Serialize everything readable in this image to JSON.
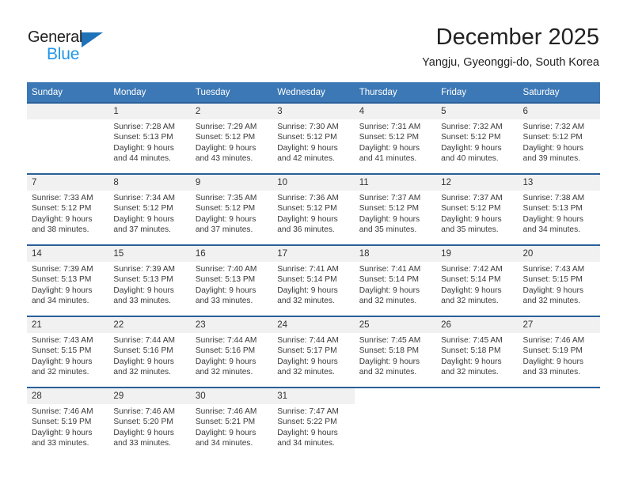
{
  "brand": {
    "name_part1": "General",
    "name_part2": "Blue",
    "triangle_color": "#1f72b8",
    "blue_color": "#2196e8"
  },
  "header": {
    "title": "December 2025",
    "subtitle": "Yangju, Gyeonggi-do, South Korea"
  },
  "theme": {
    "header_blue": "#3c78b5",
    "row_border_blue": "#2a6099",
    "daynum_strip": "#f1f1f1"
  },
  "weekdays": [
    "Sunday",
    "Monday",
    "Tuesday",
    "Wednesday",
    "Thursday",
    "Friday",
    "Saturday"
  ],
  "weeks": [
    [
      {
        "day": "",
        "sunrise": "",
        "sunset": "",
        "daylight1": "",
        "daylight2": ""
      },
      {
        "day": "1",
        "sunrise": "Sunrise: 7:28 AM",
        "sunset": "Sunset: 5:13 PM",
        "daylight1": "Daylight: 9 hours",
        "daylight2": "and 44 minutes."
      },
      {
        "day": "2",
        "sunrise": "Sunrise: 7:29 AM",
        "sunset": "Sunset: 5:12 PM",
        "daylight1": "Daylight: 9 hours",
        "daylight2": "and 43 minutes."
      },
      {
        "day": "3",
        "sunrise": "Sunrise: 7:30 AM",
        "sunset": "Sunset: 5:12 PM",
        "daylight1": "Daylight: 9 hours",
        "daylight2": "and 42 minutes."
      },
      {
        "day": "4",
        "sunrise": "Sunrise: 7:31 AM",
        "sunset": "Sunset: 5:12 PM",
        "daylight1": "Daylight: 9 hours",
        "daylight2": "and 41 minutes."
      },
      {
        "day": "5",
        "sunrise": "Sunrise: 7:32 AM",
        "sunset": "Sunset: 5:12 PM",
        "daylight1": "Daylight: 9 hours",
        "daylight2": "and 40 minutes."
      },
      {
        "day": "6",
        "sunrise": "Sunrise: 7:32 AM",
        "sunset": "Sunset: 5:12 PM",
        "daylight1": "Daylight: 9 hours",
        "daylight2": "and 39 minutes."
      }
    ],
    [
      {
        "day": "7",
        "sunrise": "Sunrise: 7:33 AM",
        "sunset": "Sunset: 5:12 PM",
        "daylight1": "Daylight: 9 hours",
        "daylight2": "and 38 minutes."
      },
      {
        "day": "8",
        "sunrise": "Sunrise: 7:34 AM",
        "sunset": "Sunset: 5:12 PM",
        "daylight1": "Daylight: 9 hours",
        "daylight2": "and 37 minutes."
      },
      {
        "day": "9",
        "sunrise": "Sunrise: 7:35 AM",
        "sunset": "Sunset: 5:12 PM",
        "daylight1": "Daylight: 9 hours",
        "daylight2": "and 37 minutes."
      },
      {
        "day": "10",
        "sunrise": "Sunrise: 7:36 AM",
        "sunset": "Sunset: 5:12 PM",
        "daylight1": "Daylight: 9 hours",
        "daylight2": "and 36 minutes."
      },
      {
        "day": "11",
        "sunrise": "Sunrise: 7:37 AM",
        "sunset": "Sunset: 5:12 PM",
        "daylight1": "Daylight: 9 hours",
        "daylight2": "and 35 minutes."
      },
      {
        "day": "12",
        "sunrise": "Sunrise: 7:37 AM",
        "sunset": "Sunset: 5:12 PM",
        "daylight1": "Daylight: 9 hours",
        "daylight2": "and 35 minutes."
      },
      {
        "day": "13",
        "sunrise": "Sunrise: 7:38 AM",
        "sunset": "Sunset: 5:13 PM",
        "daylight1": "Daylight: 9 hours",
        "daylight2": "and 34 minutes."
      }
    ],
    [
      {
        "day": "14",
        "sunrise": "Sunrise: 7:39 AM",
        "sunset": "Sunset: 5:13 PM",
        "daylight1": "Daylight: 9 hours",
        "daylight2": "and 34 minutes."
      },
      {
        "day": "15",
        "sunrise": "Sunrise: 7:39 AM",
        "sunset": "Sunset: 5:13 PM",
        "daylight1": "Daylight: 9 hours",
        "daylight2": "and 33 minutes."
      },
      {
        "day": "16",
        "sunrise": "Sunrise: 7:40 AM",
        "sunset": "Sunset: 5:13 PM",
        "daylight1": "Daylight: 9 hours",
        "daylight2": "and 33 minutes."
      },
      {
        "day": "17",
        "sunrise": "Sunrise: 7:41 AM",
        "sunset": "Sunset: 5:14 PM",
        "daylight1": "Daylight: 9 hours",
        "daylight2": "and 32 minutes."
      },
      {
        "day": "18",
        "sunrise": "Sunrise: 7:41 AM",
        "sunset": "Sunset: 5:14 PM",
        "daylight1": "Daylight: 9 hours",
        "daylight2": "and 32 minutes."
      },
      {
        "day": "19",
        "sunrise": "Sunrise: 7:42 AM",
        "sunset": "Sunset: 5:14 PM",
        "daylight1": "Daylight: 9 hours",
        "daylight2": "and 32 minutes."
      },
      {
        "day": "20",
        "sunrise": "Sunrise: 7:43 AM",
        "sunset": "Sunset: 5:15 PM",
        "daylight1": "Daylight: 9 hours",
        "daylight2": "and 32 minutes."
      }
    ],
    [
      {
        "day": "21",
        "sunrise": "Sunrise: 7:43 AM",
        "sunset": "Sunset: 5:15 PM",
        "daylight1": "Daylight: 9 hours",
        "daylight2": "and 32 minutes."
      },
      {
        "day": "22",
        "sunrise": "Sunrise: 7:44 AM",
        "sunset": "Sunset: 5:16 PM",
        "daylight1": "Daylight: 9 hours",
        "daylight2": "and 32 minutes."
      },
      {
        "day": "23",
        "sunrise": "Sunrise: 7:44 AM",
        "sunset": "Sunset: 5:16 PM",
        "daylight1": "Daylight: 9 hours",
        "daylight2": "and 32 minutes."
      },
      {
        "day": "24",
        "sunrise": "Sunrise: 7:44 AM",
        "sunset": "Sunset: 5:17 PM",
        "daylight1": "Daylight: 9 hours",
        "daylight2": "and 32 minutes."
      },
      {
        "day": "25",
        "sunrise": "Sunrise: 7:45 AM",
        "sunset": "Sunset: 5:18 PM",
        "daylight1": "Daylight: 9 hours",
        "daylight2": "and 32 minutes."
      },
      {
        "day": "26",
        "sunrise": "Sunrise: 7:45 AM",
        "sunset": "Sunset: 5:18 PM",
        "daylight1": "Daylight: 9 hours",
        "daylight2": "and 32 minutes."
      },
      {
        "day": "27",
        "sunrise": "Sunrise: 7:46 AM",
        "sunset": "Sunset: 5:19 PM",
        "daylight1": "Daylight: 9 hours",
        "daylight2": "and 33 minutes."
      }
    ],
    [
      {
        "day": "28",
        "sunrise": "Sunrise: 7:46 AM",
        "sunset": "Sunset: 5:19 PM",
        "daylight1": "Daylight: 9 hours",
        "daylight2": "and 33 minutes."
      },
      {
        "day": "29",
        "sunrise": "Sunrise: 7:46 AM",
        "sunset": "Sunset: 5:20 PM",
        "daylight1": "Daylight: 9 hours",
        "daylight2": "and 33 minutes."
      },
      {
        "day": "30",
        "sunrise": "Sunrise: 7:46 AM",
        "sunset": "Sunset: 5:21 PM",
        "daylight1": "Daylight: 9 hours",
        "daylight2": "and 34 minutes."
      },
      {
        "day": "31",
        "sunrise": "Sunrise: 7:47 AM",
        "sunset": "Sunset: 5:22 PM",
        "daylight1": "Daylight: 9 hours",
        "daylight2": "and 34 minutes."
      },
      {
        "day": "",
        "sunrise": "",
        "sunset": "",
        "daylight1": "",
        "daylight2": ""
      },
      {
        "day": "",
        "sunrise": "",
        "sunset": "",
        "daylight1": "",
        "daylight2": ""
      },
      {
        "day": "",
        "sunrise": "",
        "sunset": "",
        "daylight1": "",
        "daylight2": ""
      }
    ]
  ]
}
